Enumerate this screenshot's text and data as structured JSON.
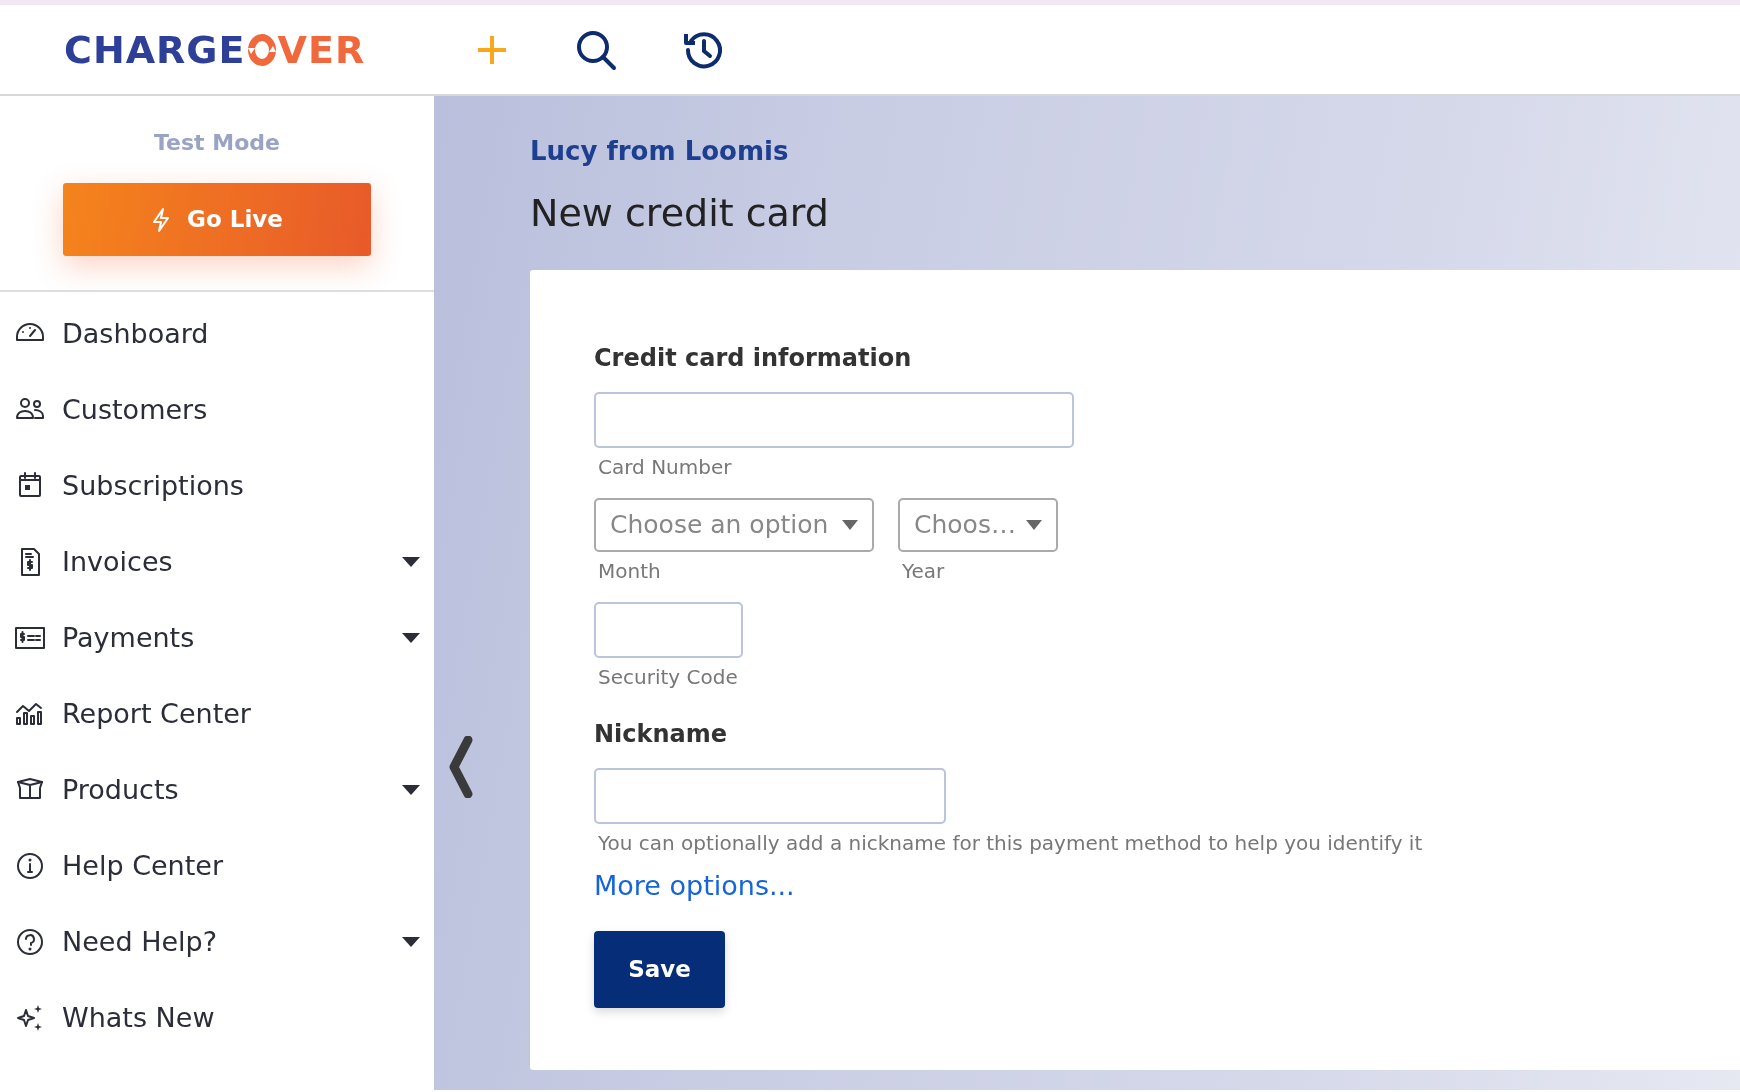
{
  "header": {
    "logo": {
      "left": "CHARGE",
      "right": "VER"
    }
  },
  "sidebar": {
    "mode_label": "Test Mode",
    "go_live_button": "Go Live",
    "items": [
      {
        "label": "Dashboard",
        "dropdown": false
      },
      {
        "label": "Customers",
        "dropdown": false
      },
      {
        "label": "Subscriptions",
        "dropdown": false
      },
      {
        "label": "Invoices",
        "dropdown": true
      },
      {
        "label": "Payments",
        "dropdown": true
      },
      {
        "label": "Report Center",
        "dropdown": false
      },
      {
        "label": "Products",
        "dropdown": true
      },
      {
        "label": "Help Center",
        "dropdown": false
      },
      {
        "label": "Need Help?",
        "dropdown": true
      },
      {
        "label": "Whats New",
        "dropdown": false
      }
    ]
  },
  "page": {
    "breadcrumb": "Lucy from Loomis",
    "title": "New credit card"
  },
  "form": {
    "section_title": "Credit card information",
    "card_number_label": "Card Number",
    "month": {
      "placeholder": "Choose an option",
      "label": "Month"
    },
    "year": {
      "placeholder": "Choos…",
      "label": "Year"
    },
    "security_code_label": "Security Code",
    "nickname_title": "Nickname",
    "nickname_help": "You can optionally add a nickname for this payment method to help you identify it",
    "more_options": "More options...",
    "save_button": "Save"
  }
}
